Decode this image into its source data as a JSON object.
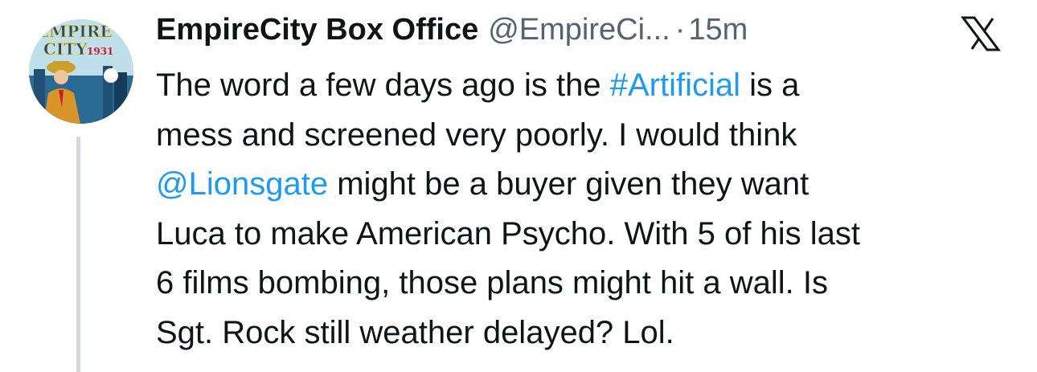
{
  "author": {
    "display_name": "EmpireCity Box Office",
    "handle": "@EmpireCi...",
    "separator": "·",
    "time": "15m",
    "avatar": {
      "text_line1": "EMPIRE",
      "text_line2": "CITY",
      "text_year": "1931"
    }
  },
  "platform": {
    "logo_icon": "x-logo-icon"
  },
  "tweet": {
    "line1_a": "The word a few days ago is the ",
    "hashtag": "#Artificial",
    "line1_b": " is a",
    "line2": "mess and screened very poorly.  I would think",
    "mention": "@Lionsgate",
    "line3_b": " might be a buyer given they want",
    "line4": "Luca to make American Psycho. With 5 of his last",
    "line5": "6 films bombing, those plans might hit a wall.  Is",
    "line6": "Sgt. Rock still weather delayed?  Lol."
  },
  "colors": {
    "link": "#1d9bf0",
    "text": "#0f1419",
    "secondary": "#536471",
    "thread_line": "#cfd9de"
  }
}
